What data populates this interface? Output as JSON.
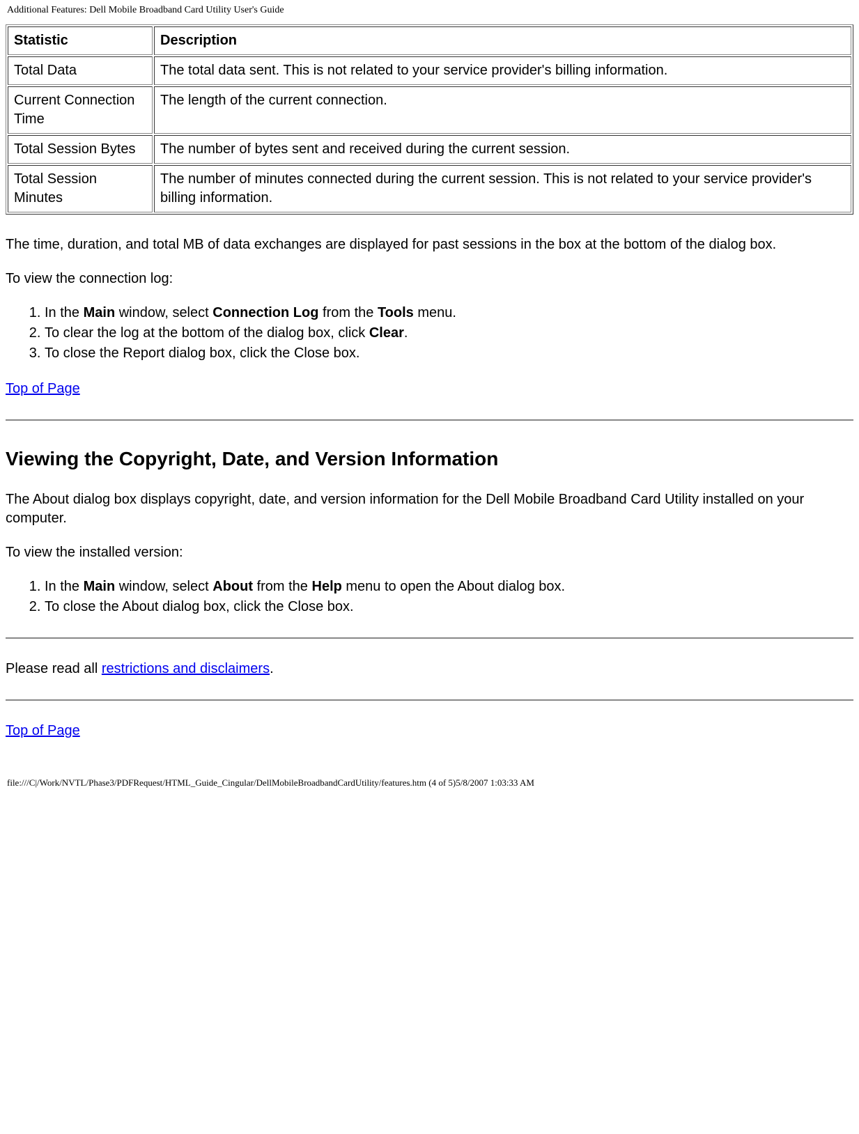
{
  "header": {
    "title": "Additional Features: Dell Mobile Broadband Card Utility User's Guide"
  },
  "table": {
    "headers": {
      "c1": "Statistic",
      "c2": "Description"
    },
    "rows": [
      {
        "c1": "Total Data",
        "c2": "The total data sent. This is not related to your service provider's billing information."
      },
      {
        "c1": "Current Connection Time",
        "c2": "The length of the current connection."
      },
      {
        "c1": "Total Session Bytes",
        "c2": "The number of bytes sent and received during the current session."
      },
      {
        "c1": "Total Session Minutes",
        "c2": "The number of minutes connected during the current session. This is not related to your service provider's billing information."
      }
    ]
  },
  "para_past_sessions": "The time, duration, and total MB of data exchanges are displayed for past sessions in the box at the bottom of the dialog box.",
  "para_view_log": "To view the connection log:",
  "steps_log": {
    "s1_a": "In the ",
    "s1_b": "Main",
    "s1_c": " window, select ",
    "s1_d": "Connection Log",
    "s1_e": " from the ",
    "s1_f": "Tools",
    "s1_g": " menu.",
    "s2_a": "To clear the log at the bottom of the dialog box, click ",
    "s2_b": "Clear",
    "s2_c": ".",
    "s3_a": "To close the Report dialog box, click the Close box."
  },
  "link_top1": "Top of Page",
  "heading_copyright": "Viewing the Copyright, Date, and Version Information",
  "para_about_intro": "The About dialog box displays copyright, date, and version information for the Dell Mobile Broadband Card Utility installed on your computer.",
  "para_view_version": "To view the installed version:",
  "steps_about": {
    "s1_a": "In the ",
    "s1_b": "Main",
    "s1_c": " window, select ",
    "s1_d": "About",
    "s1_e": " from the ",
    "s1_f": "Help",
    "s1_g": " menu to open the About dialog box.",
    "s2_a": "To close the About dialog box, click the Close box."
  },
  "para_restrict_a": "Please read all ",
  "link_restrict": "restrictions and disclaimers",
  "para_restrict_b": ".",
  "link_top2": "Top of Page",
  "footer_path": "file:///C|/Work/NVTL/Phase3/PDFRequest/HTML_Guide_Cingular/DellMobileBroadbandCardUtility/features.htm (4 of 5)5/8/2007 1:03:33 AM"
}
